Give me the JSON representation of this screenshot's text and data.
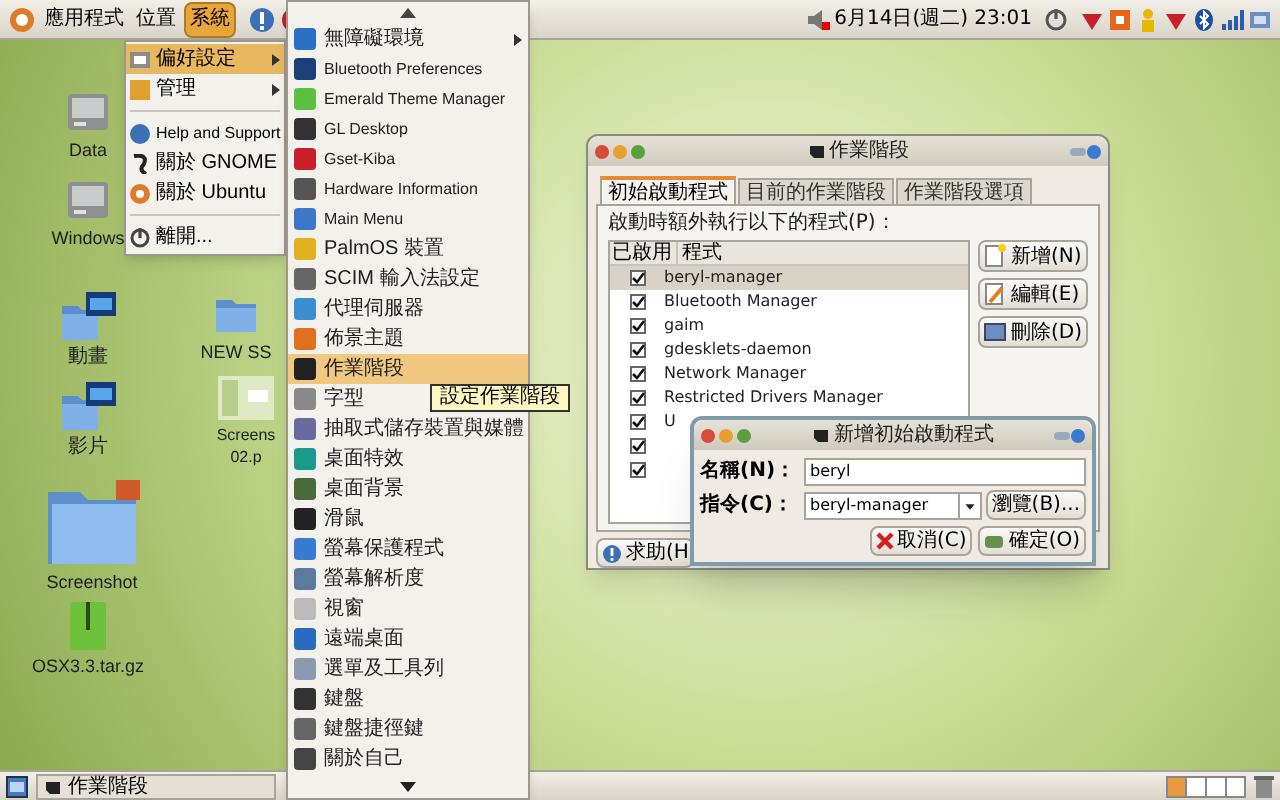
{
  "top_panel": {
    "menus": [
      {
        "label": "應用程式",
        "selected": false
      },
      {
        "label": "位置",
        "selected": false
      },
      {
        "label": "系統",
        "selected": true
      }
    ],
    "clock": "6月14日(週二) 23:01"
  },
  "desktop_icons": [
    {
      "label": "Data",
      "kind": "drive"
    },
    {
      "label": "Windows",
      "kind": "drive"
    },
    {
      "label": "動畫",
      "kind": "video-folder"
    },
    {
      "label": "NEW SS",
      "kind": "folder"
    },
    {
      "label": "影片",
      "kind": "video-folder"
    },
    {
      "label": "Screens\n02.p",
      "kind": "image"
    },
    {
      "label": "Screenshot",
      "kind": "big-folder"
    },
    {
      "label": "OSX3.3.tar.gz",
      "kind": "archive"
    }
  ],
  "system_menu": {
    "items": [
      {
        "kind": "submenu",
        "label": "偏好設定",
        "selected": true
      },
      {
        "kind": "submenu",
        "label": "管理",
        "selected": false
      },
      {
        "kind": "separator"
      },
      {
        "kind": "item",
        "label": "Help and Support",
        "selected": false
      },
      {
        "kind": "item",
        "label": "關於 GNOME",
        "selected": false
      },
      {
        "kind": "item",
        "label": "關於 Ubuntu",
        "selected": false
      },
      {
        "kind": "separator"
      },
      {
        "kind": "item",
        "label": "離開...",
        "selected": false
      }
    ]
  },
  "preferences_menu": {
    "items": [
      {
        "label": "無障礙環境",
        "submenu": true,
        "selected": false
      },
      {
        "label": "Bluetooth Preferences",
        "submenu": false,
        "selected": false
      },
      {
        "label": "Emerald Theme Manager",
        "submenu": false,
        "selected": false
      },
      {
        "label": "GL Desktop",
        "submenu": false,
        "selected": false
      },
      {
        "label": "Gset-Kiba",
        "submenu": false,
        "selected": false
      },
      {
        "label": "Hardware Information",
        "submenu": false,
        "selected": false
      },
      {
        "label": "Main Menu",
        "submenu": false,
        "selected": false
      },
      {
        "label": "PalmOS 裝置",
        "submenu": false,
        "selected": false
      },
      {
        "label": "SCIM 輸入法設定",
        "submenu": false,
        "selected": false
      },
      {
        "label": "代理伺服器",
        "submenu": false,
        "selected": false
      },
      {
        "label": "佈景主題",
        "submenu": false,
        "selected": false
      },
      {
        "label": "作業階段",
        "submenu": false,
        "selected": true
      },
      {
        "label": "字型",
        "submenu": false,
        "selected": false
      },
      {
        "label": "抽取式儲存裝置與媒體",
        "submenu": false,
        "selected": false
      },
      {
        "label": "桌面特效",
        "submenu": false,
        "selected": false
      },
      {
        "label": "桌面背景",
        "submenu": false,
        "selected": false
      },
      {
        "label": "滑鼠",
        "submenu": false,
        "selected": false
      },
      {
        "label": "螢幕保護程式",
        "submenu": false,
        "selected": false
      },
      {
        "label": "螢幕解析度",
        "submenu": false,
        "selected": false
      },
      {
        "label": "視窗",
        "submenu": false,
        "selected": false
      },
      {
        "label": "遠端桌面",
        "submenu": false,
        "selected": false
      },
      {
        "label": "選單及工具列",
        "submenu": false,
        "selected": false
      },
      {
        "label": "鍵盤",
        "submenu": false,
        "selected": false
      },
      {
        "label": "鍵盤捷徑鍵",
        "submenu": false,
        "selected": false
      },
      {
        "label": "關於自己",
        "submenu": false,
        "selected": false
      }
    ],
    "tooltip": "設定作業階段"
  },
  "session_window": {
    "title": "作業階段",
    "tabs": [
      {
        "label": "初始啟動程式",
        "selected": true
      },
      {
        "label": "目前的作業階段",
        "selected": false
      },
      {
        "label": "作業階段選項",
        "selected": false
      }
    ],
    "caption": "啟動時額外執行以下的程式(P)：",
    "columns": [
      "已啟用",
      "程式"
    ],
    "rows": [
      {
        "name": "beryl-manager",
        "checked": true,
        "selected": true
      },
      {
        "name": "Bluetooth Manager",
        "checked": true,
        "selected": false
      },
      {
        "name": "gaim",
        "checked": true,
        "selected": false
      },
      {
        "name": "gdesklets-daemon",
        "checked": true,
        "selected": false
      },
      {
        "name": "Network Manager",
        "checked": true,
        "selected": false
      },
      {
        "name": "Restricted Drivers Manager",
        "checked": true,
        "selected": false
      },
      {
        "name": "U",
        "checked": true,
        "selected": false
      },
      {
        "checked": true,
        "selected": false
      },
      {
        "checked": true,
        "selected": false
      }
    ],
    "side_buttons": [
      "新增(N)",
      "編輯(E)",
      "刪除(D)"
    ],
    "help_button": "求助(H"
  },
  "add_dialog": {
    "title": "新增初始啟動程式",
    "name_label": "名稱(N)：",
    "name_value": "beryl",
    "command_label": "指令(C)：",
    "command_value": "beryl-manager",
    "browse_button": "瀏覽(B)...",
    "cancel_button": "取消(C)",
    "ok_button": "確定(O)"
  },
  "bottom_panel": {
    "tasks": [
      "作業階段"
    ]
  }
}
